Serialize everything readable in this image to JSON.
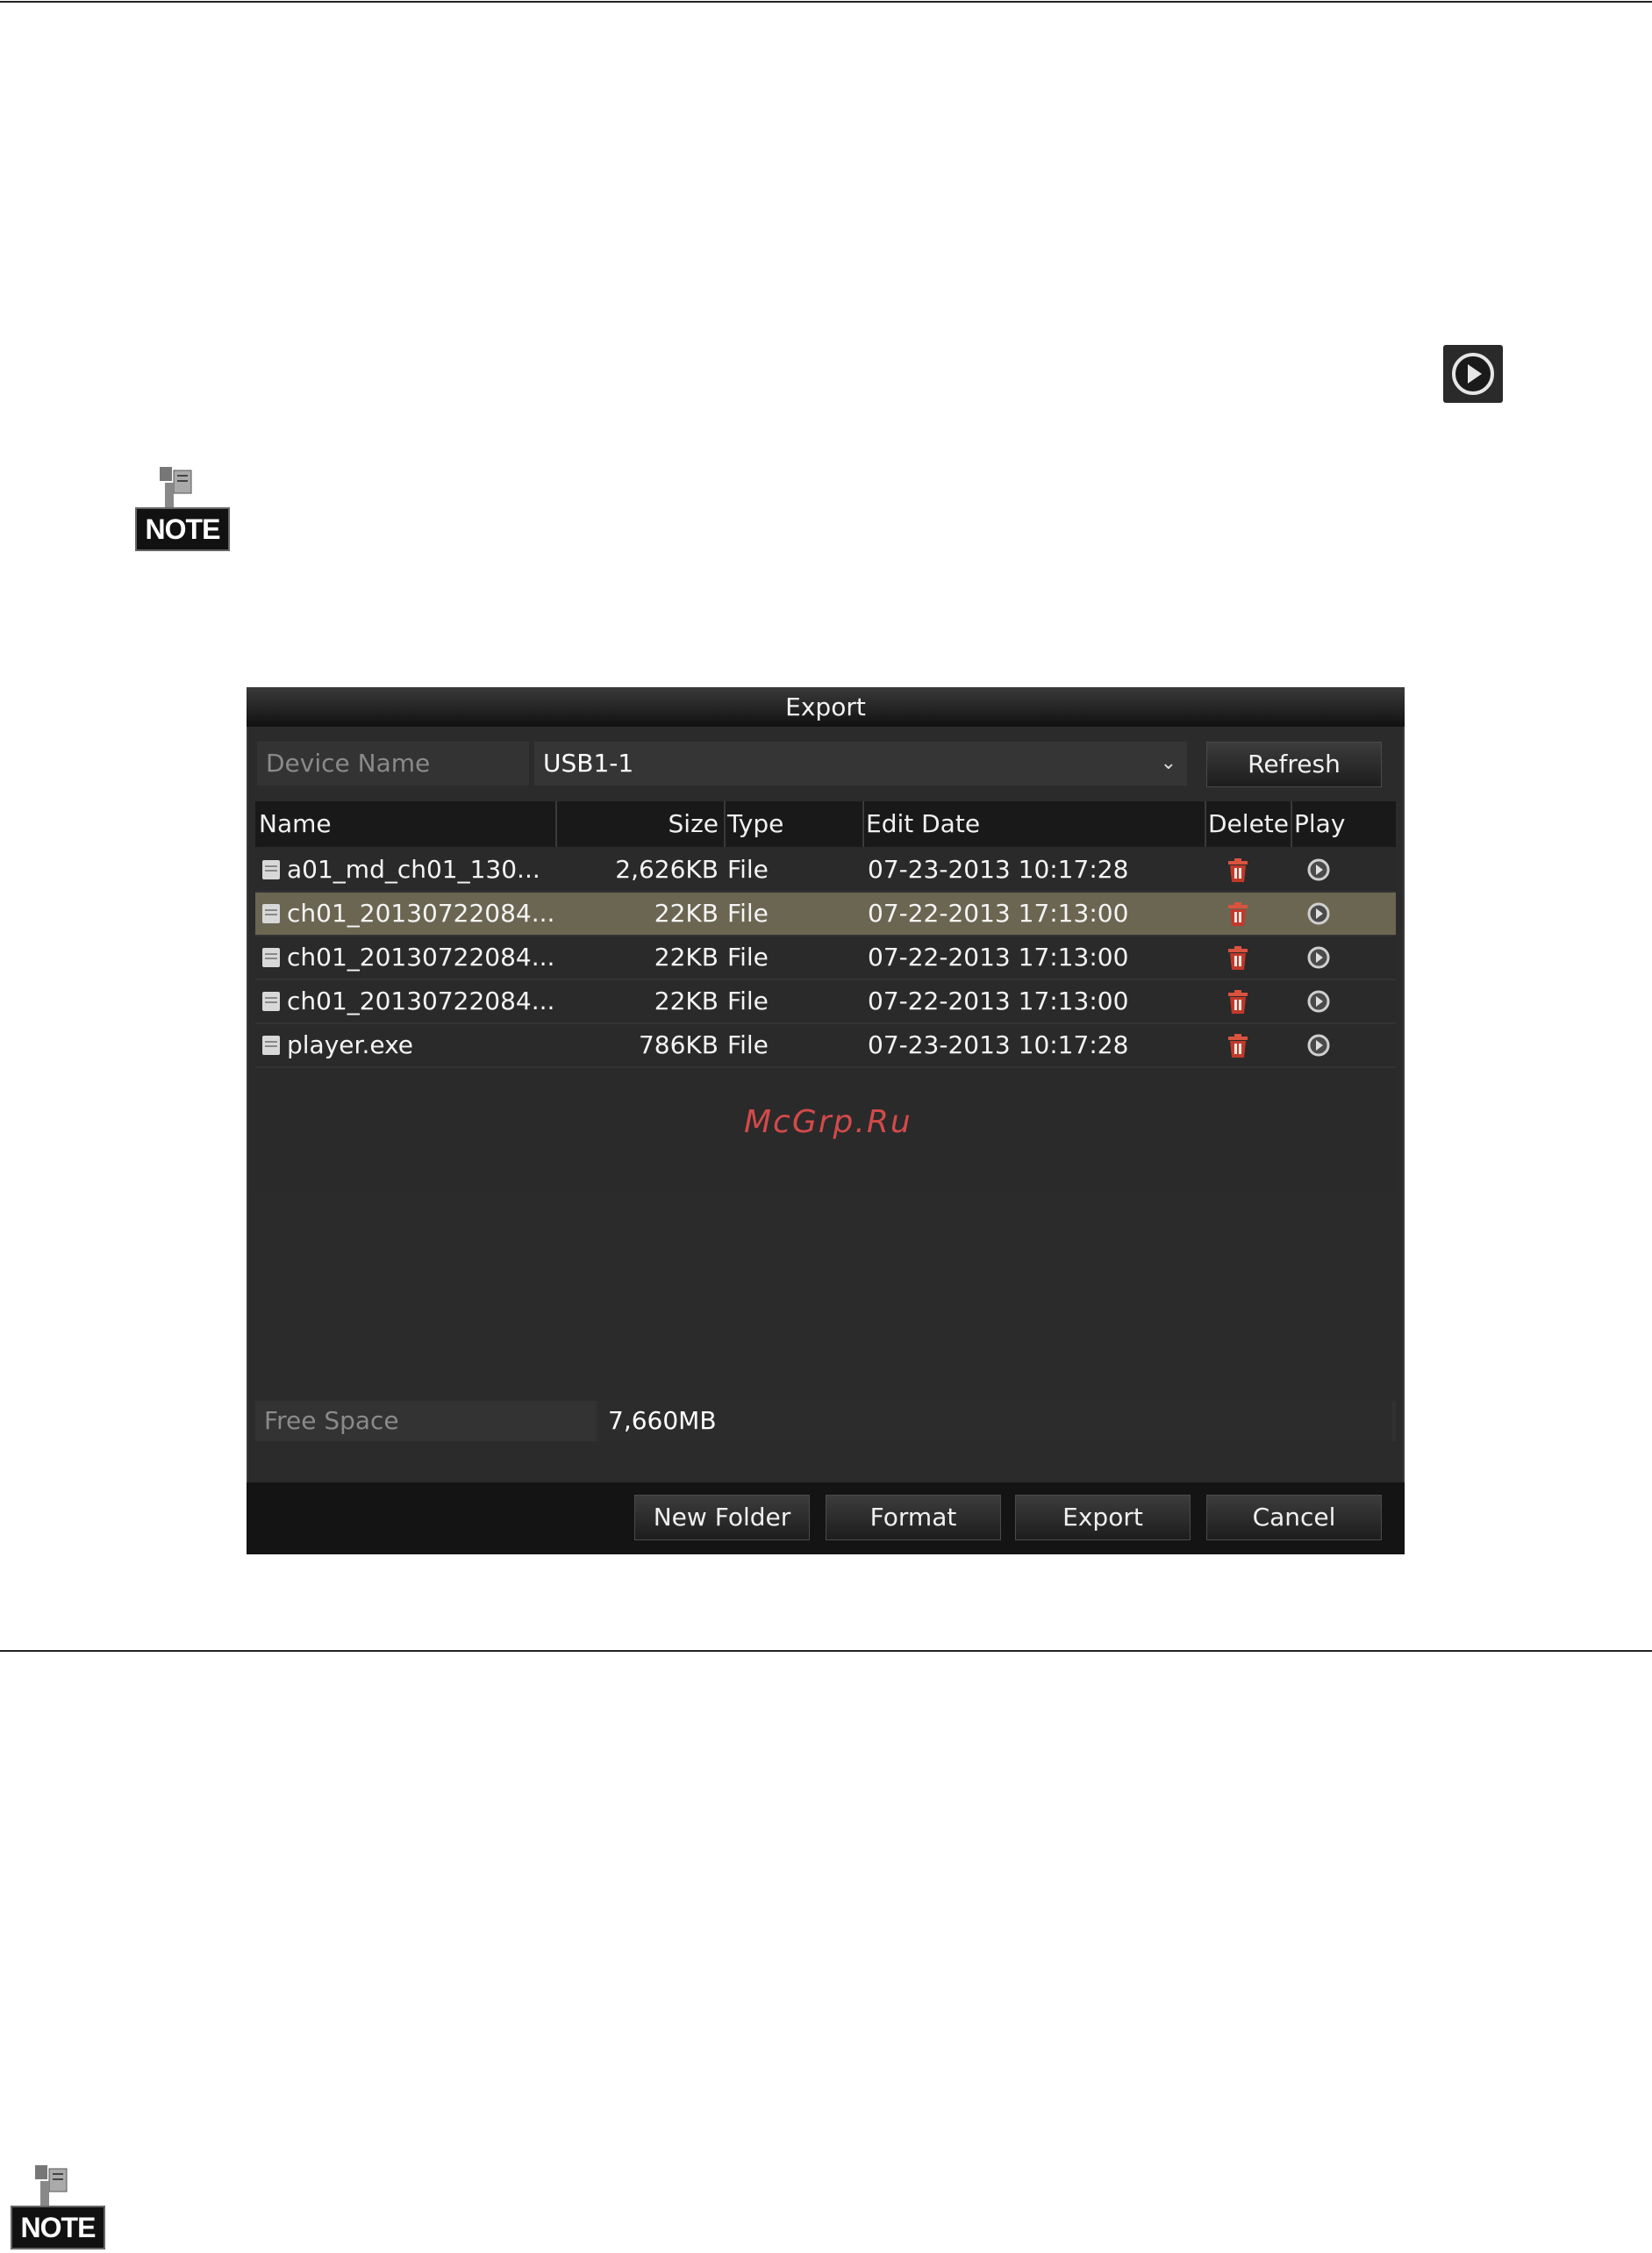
{
  "dialog": {
    "title": "Export",
    "device_label": "Device Name",
    "device_value": "USB1-1",
    "refresh_label": "Refresh",
    "columns": {
      "name": "Name",
      "size": "Size",
      "type": "Type",
      "edit_date": "Edit Date",
      "delete": "Delete",
      "play": "Play"
    },
    "rows": [
      {
        "name": "a01_md_ch01_130...",
        "size": "2,626KB",
        "type": "File",
        "date": "07-23-2013 10:17:28"
      },
      {
        "name": "ch01_20130722084...",
        "size": "22KB",
        "type": "File",
        "date": "07-22-2013 17:13:00"
      },
      {
        "name": "ch01_20130722084...",
        "size": "22KB",
        "type": "File",
        "date": "07-22-2013 17:13:00"
      },
      {
        "name": "ch01_20130722084...",
        "size": "22KB",
        "type": "File",
        "date": "07-22-2013 17:13:00"
      },
      {
        "name": "player.exe",
        "size": "786KB",
        "type": "File",
        "date": "07-23-2013 10:17:28"
      }
    ],
    "selected_row": 1,
    "free_space_label": "Free Space",
    "free_space_value": "7,660MB",
    "buttons": {
      "new_folder": "New Folder",
      "format": "Format",
      "export": "Export",
      "cancel": "Cancel"
    }
  },
  "notes": {
    "label": "NOTE"
  },
  "watermark": "McGrp.Ru",
  "colors": {
    "dialog_bg": "#2b2b2b",
    "selected_row": "#6b6652",
    "delete_icon": "#c0392b",
    "watermark": "#d24a4a"
  },
  "icons": {
    "inline_play": "play-circle-icon",
    "delete": "trash-icon",
    "play": "play-circle-icon",
    "file": "file-icon"
  }
}
